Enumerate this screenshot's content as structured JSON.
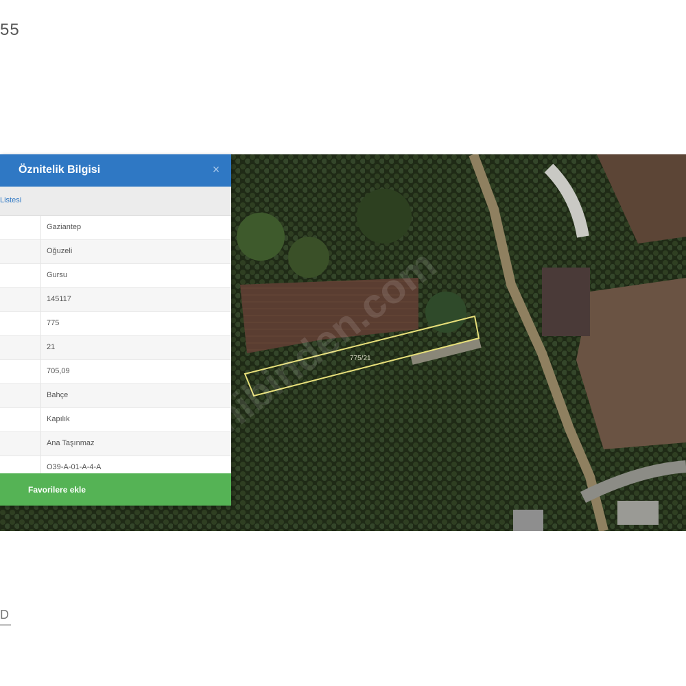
{
  "corner_text": "55",
  "panel": {
    "title": "Öznitelik Bilgisi",
    "close_symbol": "×",
    "tab_label": "Listesi",
    "values": [
      "Gaziantep",
      "Oğuzeli",
      "Gursu",
      "145117",
      "775",
      "21",
      "705,09",
      "Bahçe",
      "Kapılık",
      "Ana Taşınmaz",
      "O39-A-01-A-4-A"
    ],
    "favorite_label": "Favorilere ekle"
  },
  "map": {
    "parcel_label": "775/21",
    "watermark": "sahibinden.com"
  },
  "colors": {
    "header": "#2f78c4",
    "button": "#55b355",
    "parcel_outline": "#e8e07a"
  }
}
